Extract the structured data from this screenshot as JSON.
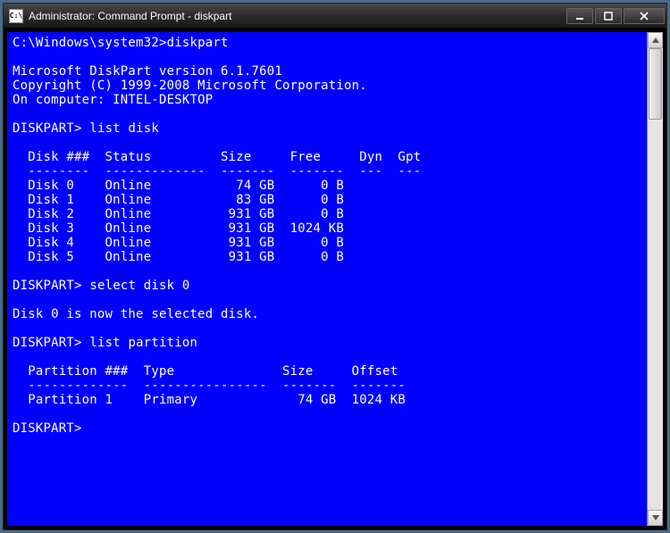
{
  "window": {
    "title": "Administrator: Command Prompt - diskpart"
  },
  "terminal": {
    "prompt_path": "C:\\Windows\\system32>",
    "cmd_start": "diskpart",
    "header_lines": [
      "Microsoft DiskPart version 6.1.7601",
      "Copyright (C) 1999-2008 Microsoft Corporation.",
      "On computer: INTEL-DESKTOP"
    ],
    "dp_prompt": "DISKPART>",
    "cmd_list_disk": "list disk",
    "disk_header": "  Disk ###  Status         Size     Free     Dyn  Gpt",
    "disk_divider": "  --------  -------------  -------  -------  ---  ---",
    "disks": [
      "  Disk 0    Online           74 GB      0 B",
      "  Disk 1    Online           83 GB      0 B",
      "  Disk 2    Online          931 GB      0 B",
      "  Disk 3    Online          931 GB  1024 KB",
      "  Disk 4    Online          931 GB      0 B",
      "  Disk 5    Online          931 GB      0 B"
    ],
    "cmd_select_disk": "select disk 0",
    "msg_selected": "Disk 0 is now the selected disk.",
    "cmd_list_partition": "list partition",
    "part_header": "  Partition ###  Type              Size     Offset",
    "part_divider": "  -------------  ----------------  -------  -------",
    "partitions": [
      "  Partition 1    Primary             74 GB  1024 KB"
    ]
  }
}
